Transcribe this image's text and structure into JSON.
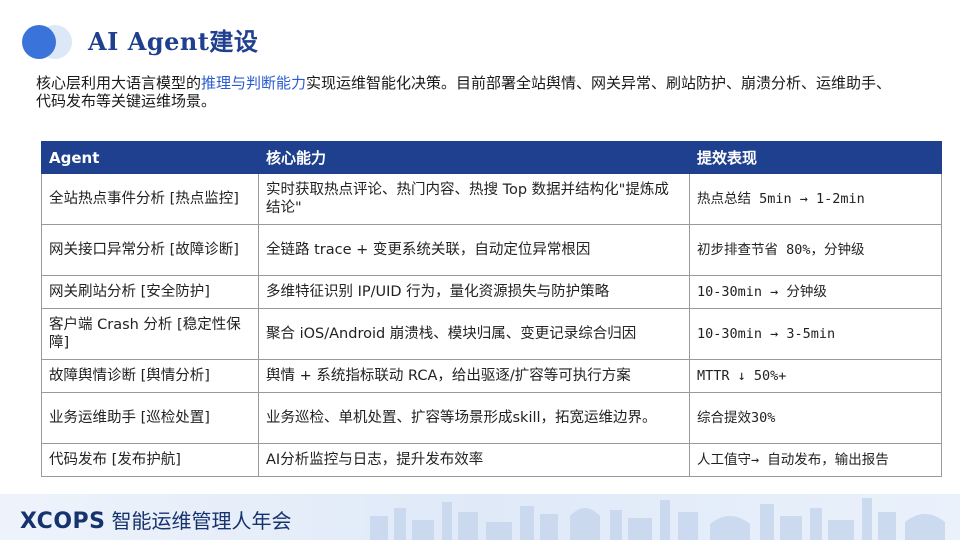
{
  "header": {
    "title": "AI Agent建设"
  },
  "intro": {
    "part1": "核心层利用大语言模型的",
    "highlight": "推理与判断能力",
    "part2": "实现运维智能化决策。目前部署全站舆情、网关异常、刷站防护、崩溃分析、运维助手、代码发布等关键运维场景。"
  },
  "table": {
    "headers": [
      "Agent",
      "核心能力",
      "提效表现"
    ],
    "rows": [
      [
        "全站热点事件分析 [热点监控]",
        "实时获取热点评论、热门内容、热搜 Top 数据并结构化\"提炼成结论\"",
        "热点总结 5min → 1-2min"
      ],
      [
        "网关接口异常分析 [故障诊断]",
        "全链路 trace + 变更系统关联，自动定位异常根因",
        "初步排查节省 80%，分钟级"
      ],
      [
        "网关刷站分析 [安全防护]",
        "多维特征识别 IP/UID 行为，量化资源损失与防护策略",
        "10-30min → 分钟级"
      ],
      [
        "客户端 Crash 分析 [稳定性保障]",
        "聚合 iOS/Android 崩溃栈、模块归属、变更记录综合归因",
        "10-30min → 3-5min"
      ],
      [
        "故障舆情诊断 [舆情分析]",
        "舆情 + 系统指标联动 RCA，给出驱逐/扩容等可执行方案",
        "MTTR ↓ 50%+"
      ],
      [
        "业务运维助手 [巡检处置]",
        "业务巡检、单机处置、扩容等场景形成skill，拓宽运维边界。",
        "综合提效30%"
      ],
      [
        "代码发布 [发布护航]",
        "AI分析监控与日志，提升发布效率",
        "人工值守→ 自动发布，输出报告"
      ]
    ]
  },
  "footer": {
    "brand": "XCOPS",
    "event": "智能运维管理人年会"
  },
  "colors": {
    "accent": "#1f3f8f",
    "highlight": "#2b5bd0"
  }
}
